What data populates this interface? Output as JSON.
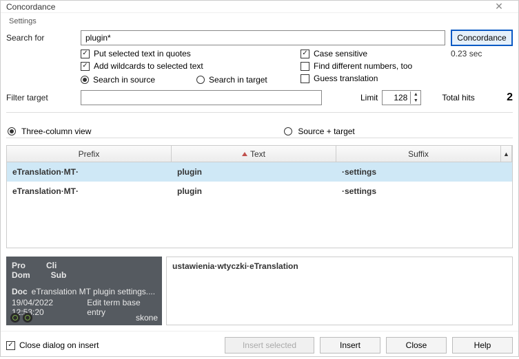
{
  "window": {
    "title": "Concordance"
  },
  "settings_label": "Settings",
  "search": {
    "label": "Search for",
    "value": "plugin*",
    "button": "Concordance",
    "put_quotes": "Put selected text in quotes",
    "add_wildcards": "Add wildcards to selected text",
    "search_source": "Search in source",
    "search_target": "Search in target",
    "case_sensitive": "Case sensitive",
    "find_diff_numbers": "Find different numbers, too",
    "guess_translation": "Guess translation",
    "time": "0.23 sec"
  },
  "filter": {
    "label": "Filter target",
    "limit_label": "Limit",
    "limit_value": "128",
    "total_hits_label": "Total hits",
    "total_hits_value": "2"
  },
  "view": {
    "three_col": "Three-column view",
    "src_tgt": "Source + target"
  },
  "table": {
    "headers": {
      "prefix": "Prefix",
      "text": "Text",
      "suffix": "Suffix"
    },
    "rows": [
      {
        "prefix": "eTranslation·MT·",
        "text": "plugin",
        "suffix": "·settings"
      },
      {
        "prefix": "eTranslation·MT·",
        "text": "plugin",
        "suffix": "·settings"
      }
    ]
  },
  "meta": {
    "pro": "Pro",
    "cli": "Cli",
    "dom": "Dom",
    "sub": "Sub",
    "doc_label": "Doc",
    "doc_value": "eTranslation MT plugin settings....",
    "ts": "19/04/2022 12:53:20",
    "action": "Edit term base entry",
    "user": "skone"
  },
  "target_text": "ustawienia·wtyczki·eTranslation",
  "footer": {
    "close_on_insert": "Close dialog on insert",
    "insert_selected": "Insert selected",
    "insert": "Insert",
    "close": "Close",
    "help": "Help"
  }
}
